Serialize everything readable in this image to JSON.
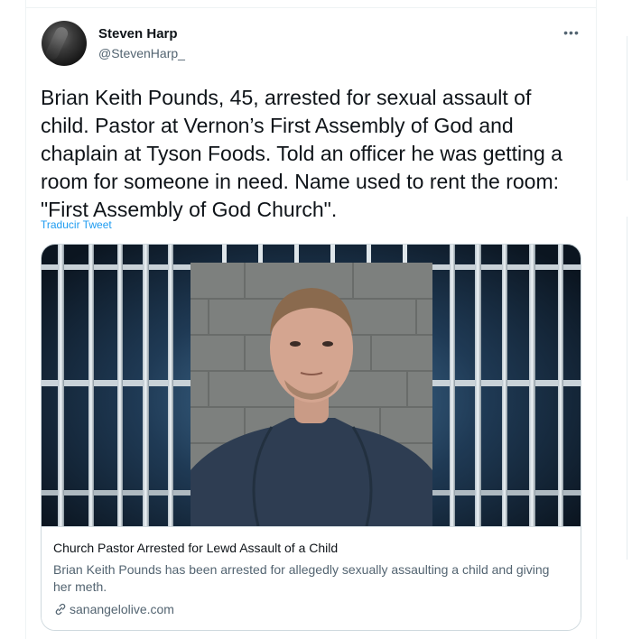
{
  "tweet": {
    "author": {
      "display_name": "Steven Harp",
      "handle": "@StevenHarp_"
    },
    "more_icon": "more-horizontal-icon",
    "text": "Brian Keith Pounds, 45, arrested for sexual assault of child. Pastor at Vernon’s First Assembly of God and chaplain at Tyson Foods. Told an officer he was getting a room for someone in need. Name used to rent the room: \"First Assembly of God Church\".",
    "translate_label": "Traducir Tweet",
    "link_card": {
      "title": "Church Pastor Arrested for Lewd Assault of a Child",
      "description": "Brian Keith Pounds has been arrested for allegedly sexually assaulting a child and giving her meth.",
      "domain": "sanangelolive.com",
      "domain_icon": "link-icon"
    }
  },
  "colors": {
    "text_primary": "#0f1419",
    "text_secondary": "#536471",
    "link_blue": "#1d9bf0",
    "border": "#cfd9de"
  }
}
